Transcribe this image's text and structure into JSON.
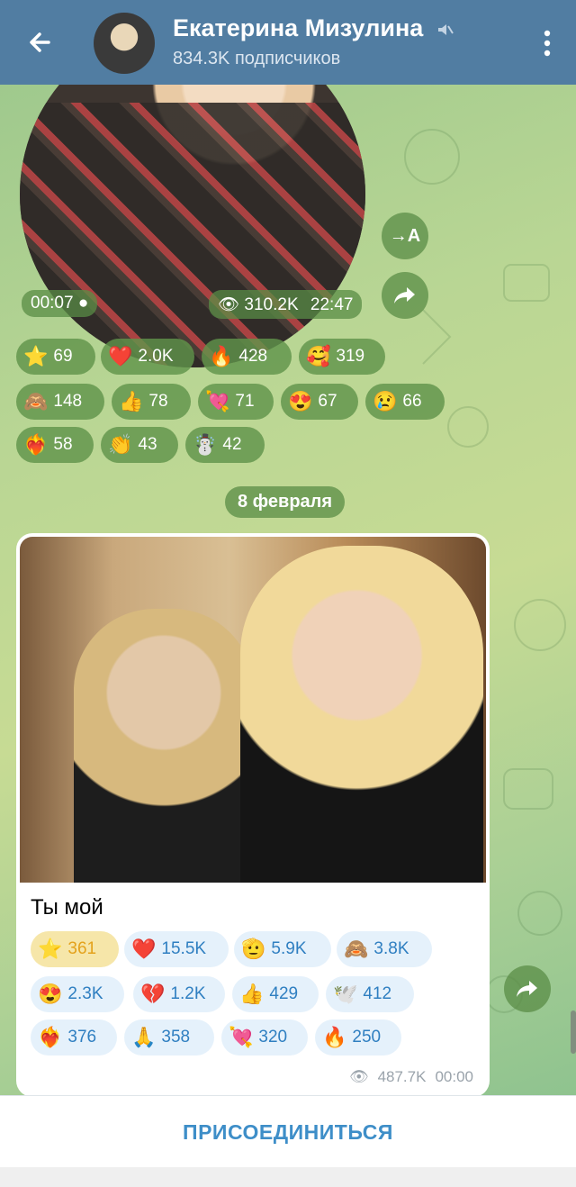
{
  "header": {
    "title": "Екатерина Мизулина",
    "subtitle": "834.3K подписчиков",
    "bg_color": "#517da2"
  },
  "video_message": {
    "duration": "00:07",
    "views": "310.2K",
    "time": "22:47",
    "translate_label": "→A",
    "reactions": [
      {
        "emoji": "⭐",
        "count": "69"
      },
      {
        "emoji": "❤️",
        "count": "2.0K"
      },
      {
        "emoji": "🔥",
        "count": "428"
      },
      {
        "emoji": "🥰",
        "count": "319"
      },
      {
        "emoji": "🙈",
        "count": "148"
      },
      {
        "emoji": "👍",
        "count": "78"
      },
      {
        "emoji": "💘",
        "count": "71"
      },
      {
        "emoji": "😍",
        "count": "67"
      },
      {
        "emoji": "😢",
        "count": "66"
      },
      {
        "emoji": "❤️‍🔥",
        "count": "58"
      },
      {
        "emoji": "👏",
        "count": "43"
      },
      {
        "emoji": "☃️",
        "count": "42"
      }
    ]
  },
  "date_separator": "8 февраля",
  "photo_message": {
    "caption": "Ты мой",
    "views": "487.7K",
    "time": "00:00",
    "reactions": [
      {
        "emoji": "⭐",
        "count": "361",
        "selected": true
      },
      {
        "emoji": "❤️",
        "count": "15.5K"
      },
      {
        "emoji": "🫡",
        "count": "5.9K"
      },
      {
        "emoji": "🙈",
        "count": "3.8K"
      },
      {
        "emoji": "😍",
        "count": "2.3K"
      },
      {
        "emoji": "💔",
        "count": "1.2K"
      },
      {
        "emoji": "👍",
        "count": "429"
      },
      {
        "emoji": "🕊️",
        "count": "412"
      },
      {
        "emoji": "❤️‍🔥",
        "count": "376"
      },
      {
        "emoji": "🙏",
        "count": "358"
      },
      {
        "emoji": "💘",
        "count": "320"
      },
      {
        "emoji": "🔥",
        "count": "250"
      }
    ]
  },
  "footer": {
    "join_label": "ПРИСОЕДИНИТЬСЯ"
  }
}
